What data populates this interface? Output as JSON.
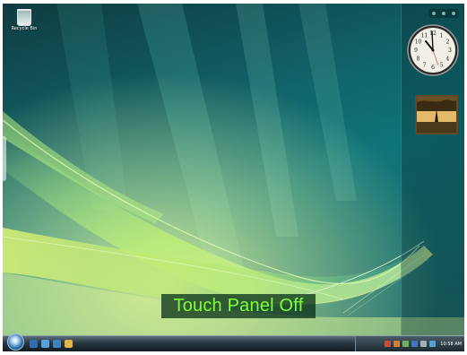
{
  "desktop": {
    "recycle_bin_label": "Recycle Bin"
  },
  "osd": {
    "message": "Touch Panel Off",
    "text_color": "#7cff34"
  },
  "sidebar": {
    "clock": {
      "hour_numbers": [
        "12",
        "1",
        "2",
        "3",
        "4",
        "5",
        "6",
        "7",
        "8",
        "9",
        "10",
        "11"
      ]
    }
  },
  "taskbar": {
    "start_icon": "windows-orb-icon",
    "quick_launch": [
      "show-desktop-icon",
      "switch-windows-icon",
      "internet-explorer-icon",
      "folder-icon"
    ],
    "tray_icons": [
      "network-icon",
      "shield-icon",
      "battery-icon",
      "wireless-icon",
      "volume-icon",
      "touch-icon"
    ],
    "time": "10:58 AM"
  },
  "colors": {
    "wallpaper_teal": "#0b6f77",
    "wallpaper_glow": "#e8f56a",
    "taskbar": "#1b2830"
  }
}
